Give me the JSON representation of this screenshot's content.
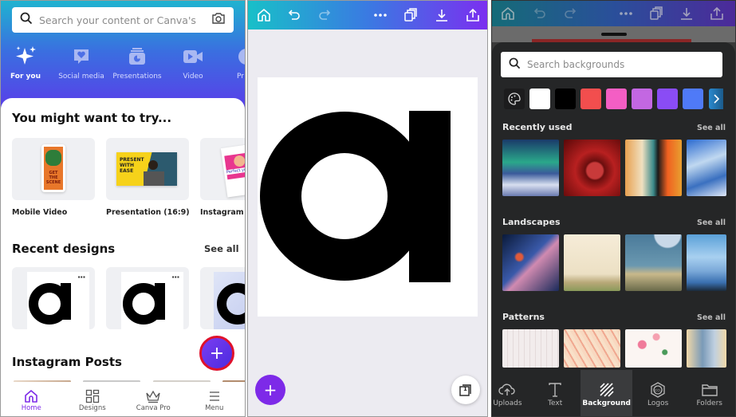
{
  "home": {
    "search_placeholder": "Search your content or Canva's",
    "categories": [
      {
        "label": "For you",
        "icon": "sparkle-icon",
        "active": true
      },
      {
        "label": "Social media",
        "icon": "heart-chat-icon"
      },
      {
        "label": "Presentations",
        "icon": "presentation-icon"
      },
      {
        "label": "Video",
        "icon": "video-camera-icon"
      },
      {
        "label": "Pr"
      }
    ],
    "try_section": {
      "title": "You might want to try...",
      "items": [
        {
          "label": "Mobile Video",
          "thumb_text": "GET THE SCENE"
        },
        {
          "label": "Presentation (16:9)",
          "thumb_text": "PRESENT WITH EASE"
        },
        {
          "label": "Instagram Po",
          "thumb_text": "Perfect your p"
        }
      ]
    },
    "recent_section": {
      "title": "Recent designs",
      "see_all": "See all",
      "more_label": "···"
    },
    "instagram_section": {
      "title": "Instagram Posts"
    },
    "fab_label": "+",
    "bottom_nav": [
      {
        "label": "Home",
        "active": true
      },
      {
        "label": "Designs"
      },
      {
        "label": "Canva Pro"
      },
      {
        "label": "Menu"
      }
    ]
  },
  "editor": {
    "canvas_letter": "a",
    "add_label": "+",
    "page_count": "1"
  },
  "backgrounds": {
    "search_placeholder": "Search backgrounds",
    "swatches": [
      "#ffffff",
      "#000000",
      "#f24e4e",
      "#f45ec4",
      "#c367e2",
      "#8a4cf5",
      "#4f7af7"
    ],
    "sections": [
      {
        "title": "Recently used",
        "see_all": "See all"
      },
      {
        "title": "Landscapes",
        "see_all": "See all"
      },
      {
        "title": "Patterns",
        "see_all": "See all"
      }
    ],
    "bottom_nav": [
      {
        "label": "Uploads"
      },
      {
        "label": "Text"
      },
      {
        "label": "Background",
        "active": true
      },
      {
        "label": "Logos"
      },
      {
        "label": "Folders"
      }
    ]
  },
  "colors": {
    "accent": "#7d2ae8",
    "fab_ring": "#e0112b"
  }
}
